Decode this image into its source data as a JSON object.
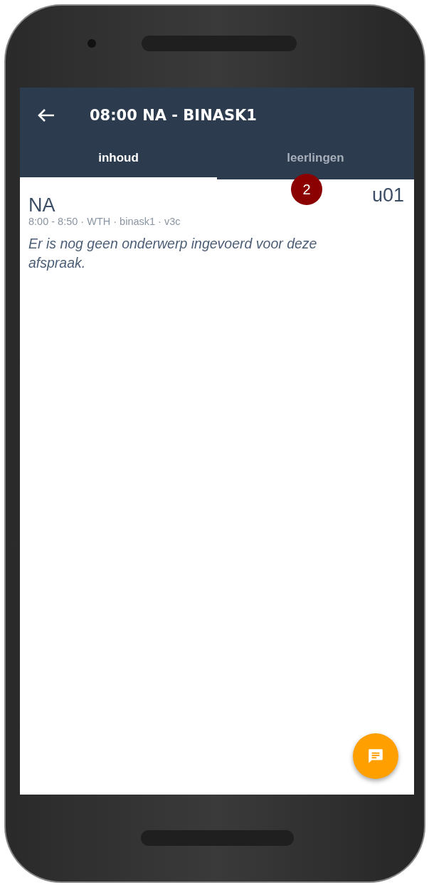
{
  "appbar": {
    "title": "08:00 NA - BINASK1"
  },
  "tabs": [
    {
      "label": "inhoud",
      "selected": true
    },
    {
      "label": "leerlingen",
      "selected": false
    }
  ],
  "badge": "2",
  "lesson": {
    "subject": "NA",
    "room": "u01",
    "details": "8:00 - 8:50 · WTH · binask1 · v3c",
    "note": "Er is nog geen onderwerp ingevoerd voor deze afspraak."
  }
}
